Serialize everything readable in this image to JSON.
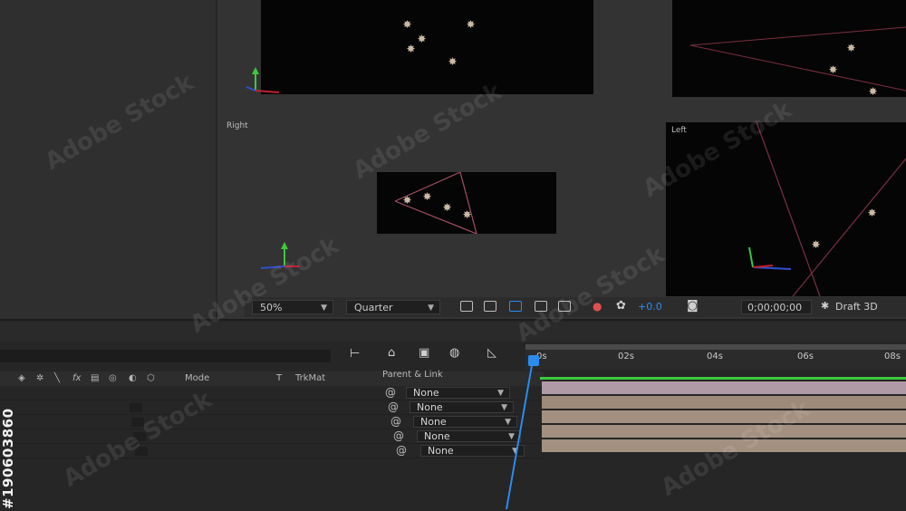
{
  "viewer": {
    "views": [
      {
        "label": "Right"
      },
      {
        "label": "Left"
      }
    ],
    "toolbar": {
      "zoom": "50%",
      "resolution": "Quarter",
      "exposure": "+0.0",
      "timecode": "0;00;00;00",
      "renderer": "Draft 3D"
    }
  },
  "timeline": {
    "columns": {
      "mode": "Mode",
      "t": "T",
      "trkmat": "TrkMat",
      "parent_link": "Parent & Link"
    },
    "header_icons": [
      "solo-icon",
      "shy-icon",
      "collapse-icon",
      "quality-icon",
      "fx-icon",
      "frame-blend-icon",
      "motion-blur-icon",
      "adjustment-icon",
      "3d-icon"
    ],
    "layers": [
      {
        "parent": "None"
      },
      {
        "parent": "None"
      },
      {
        "parent": "None"
      },
      {
        "parent": "None"
      },
      {
        "parent": "None"
      }
    ],
    "ruler": {
      "labels": [
        "0s",
        "02s",
        "04s",
        "06s",
        "08s"
      ]
    },
    "colors": {
      "bar": "#9e8a78",
      "bar_selected": "#b09aa6",
      "playhead": "#2b8cf0",
      "work_area_green": "#3cc93c"
    }
  },
  "watermark": {
    "id_text": "#190603860",
    "brand_text": "Adobe Stock"
  }
}
